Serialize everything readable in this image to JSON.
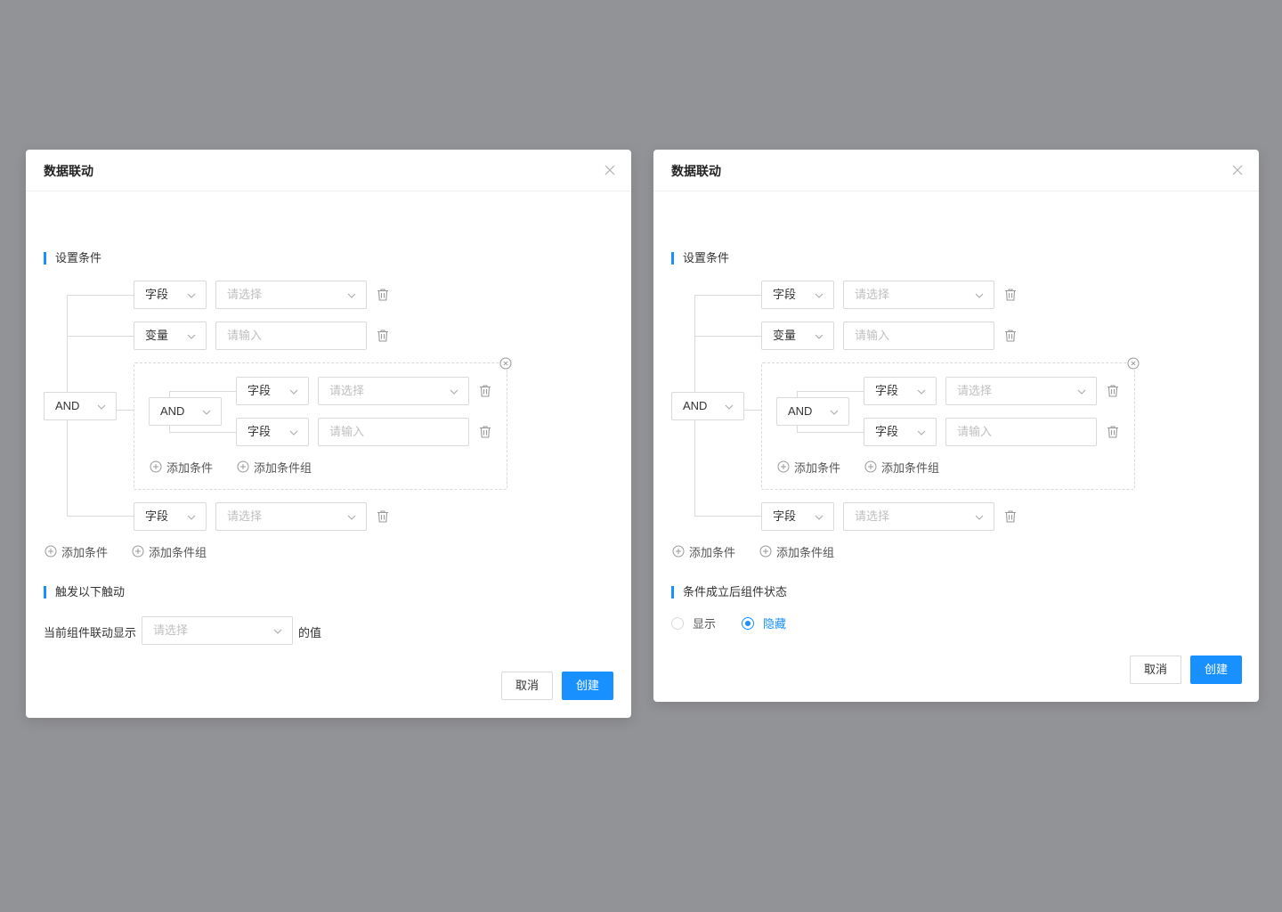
{
  "colors": {
    "accent": "#1890ff",
    "border": "#d9d9d9",
    "backdrop": "#929396"
  },
  "dialogs": [
    {
      "title": "数据联动",
      "section1_title": "设置条件",
      "root_operator": "AND",
      "rows": [
        {
          "type_value": "字段",
          "value_placeholder": "请选择"
        },
        {
          "type_value": "变量",
          "value_placeholder": "请输入"
        },
        {
          "type_value": "字段",
          "value_placeholder": "请选择"
        }
      ],
      "group": {
        "operator": "AND",
        "rows": [
          {
            "type_value": "字段",
            "value_placeholder": "请选择"
          },
          {
            "type_value": "字段",
            "value_placeholder": "请输入"
          }
        ],
        "add_condition": "添加条件",
        "add_condition_group": "添加条件组"
      },
      "add_condition": "添加条件",
      "add_condition_group": "添加条件组",
      "section2_title": "触发以下触动",
      "trigger_label": "当前组件联动显示",
      "trigger_placeholder": "请选择",
      "trigger_suffix": "的值",
      "cancel_label": "取消",
      "create_label": "创建"
    },
    {
      "title": "数据联动",
      "section1_title": "设置条件",
      "root_operator": "AND",
      "rows": [
        {
          "type_value": "字段",
          "value_placeholder": "请选择"
        },
        {
          "type_value": "变量",
          "value_placeholder": "请输入"
        },
        {
          "type_value": "字段",
          "value_placeholder": "请选择"
        }
      ],
      "group": {
        "operator": "AND",
        "rows": [
          {
            "type_value": "字段",
            "value_placeholder": "请选择"
          },
          {
            "type_value": "字段",
            "value_placeholder": "请输入"
          }
        ],
        "add_condition": "添加条件",
        "add_condition_group": "添加条件组"
      },
      "add_condition": "添加条件",
      "add_condition_group": "添加条件组",
      "section2_title": "条件成立后组件状态",
      "radio_show": "显示",
      "radio_hide": "隐藏",
      "selected_state": "隐藏",
      "cancel_label": "取消",
      "create_label": "创建"
    }
  ]
}
